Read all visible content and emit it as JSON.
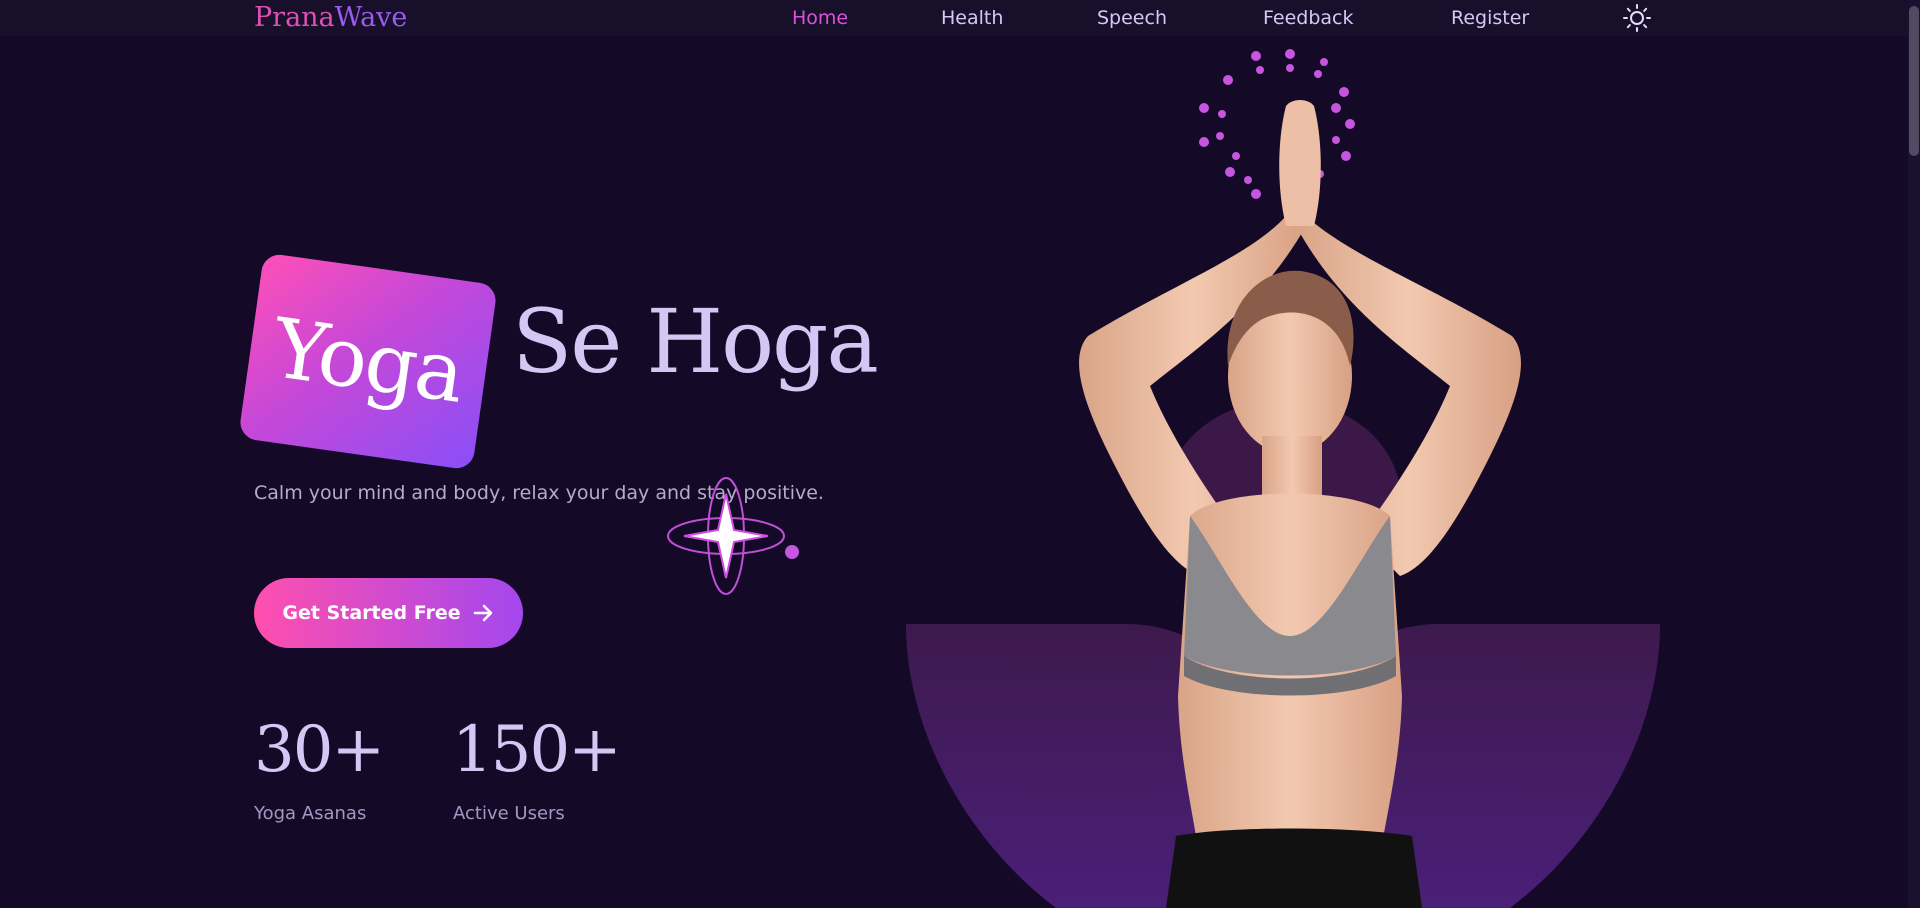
{
  "nav": {
    "logo_prefix": "Prana",
    "logo_suffix": "Wave",
    "links": [
      {
        "label": "Home",
        "active": true
      },
      {
        "label": "Health",
        "active": false
      },
      {
        "label": "Speech",
        "active": false
      },
      {
        "label": "Feedback",
        "active": false
      },
      {
        "label": "Register",
        "active": false
      }
    ],
    "theme_icon": "sun-icon"
  },
  "hero": {
    "title_highlight": "Yoga",
    "title_rest": "Se Hoga",
    "subtitle": "Calm your mind and body, relax your day and stay positive.",
    "cta_label": "Get Started Free",
    "cta_icon": "arrow-right-icon"
  },
  "stats": [
    {
      "value": "30+",
      "label": "Yoga Asanas"
    },
    {
      "value": "150+",
      "label": "Active Users"
    }
  ],
  "colors": {
    "background": "#140a27",
    "accent_pink": "#ff4fae",
    "accent_purple": "#8a4ff7",
    "heading": "#d6c6f3"
  }
}
